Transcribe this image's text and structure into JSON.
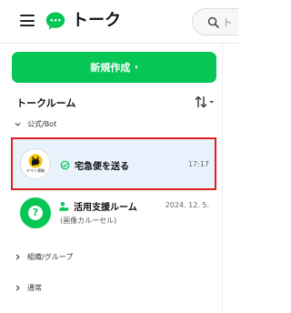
{
  "header": {
    "title": "トーク",
    "search_placeholder": "ト"
  },
  "new_button": {
    "label": "新規作成",
    "caret": "▾"
  },
  "list": {
    "title": "トークルーム",
    "sections": {
      "pinned": "公式/Bot",
      "groups": "組織/グループ",
      "normal": "通常"
    }
  },
  "chats": [
    {
      "name": "宅急便を送る",
      "time": "17:17",
      "avatar_text": "ヤマト運輸",
      "icon": "official-bot-icon",
      "selected": true
    },
    {
      "name": "活用支援ルーム",
      "time": "2024. 12. 5.",
      "preview": "(画像カルーセル)",
      "icon": "user-support-icon",
      "avatar_icon": "help-question-icon"
    }
  ],
  "colors": {
    "brand_green": "#06c755",
    "selected_background": "#e7f2fd",
    "highlight_border": "#e0201b"
  }
}
